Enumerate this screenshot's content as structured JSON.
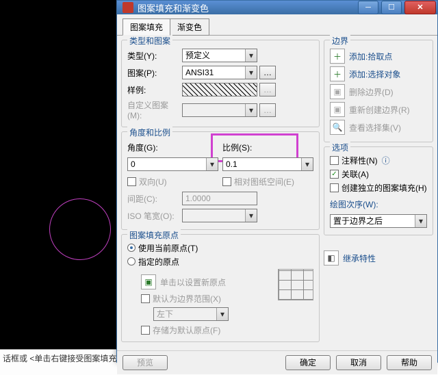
{
  "dialog": {
    "title": "图案填充和渐变色",
    "tabs": {
      "hatch": "图案填充",
      "gradient": "渐变色"
    }
  },
  "type_pattern": {
    "group": "类型和图案",
    "type_label": "类型(Y):",
    "type_value": "预定义",
    "pattern_label": "图案(P):",
    "pattern_value": "ANSI31",
    "sample_label": "样例:",
    "custom_label": "自定义图案(M):"
  },
  "angle_scale": {
    "group": "角度和比例",
    "angle_label": "角度(G):",
    "angle_value": "0",
    "scale_label": "比例(S):",
    "scale_value": "0.1",
    "double_label": "双向(U)",
    "paper_label": "相对图纸空间(E)",
    "spacing_label": "间距(C):",
    "spacing_value": "1.0000",
    "iso_label": "ISO 笔宽(O):"
  },
  "origin": {
    "group": "图案填充原点",
    "use_current": "使用当前原点(T)",
    "specified": "指定的原点",
    "click_set": "单击以设置新原点",
    "default_bounds": "默认为边界范围(X)",
    "position_value": "左下",
    "store_default": "存储为默认原点(F)"
  },
  "boundaries": {
    "group": "边界",
    "add_pick": "添加:拾取点",
    "add_select": "添加:选择对象",
    "remove": "删除边界(D)",
    "recreate": "重新创建边界(R)",
    "view_sel": "查看选择集(V)"
  },
  "options": {
    "group": "选项",
    "annotative": "注释性(N)",
    "assoc": "关联(A)",
    "create_sep": "创建独立的图案填充(H)",
    "draw_order_label": "绘图次序(W):",
    "draw_order_value": "置于边界之后",
    "inherit": "继承特性"
  },
  "footer": {
    "preview": "预览",
    "ok": "确定",
    "cancel": "取消",
    "help": "帮助"
  },
  "bottom_hint": "话框或 <单击右键接受图案填充>:",
  "info_icon": "ⓘ"
}
